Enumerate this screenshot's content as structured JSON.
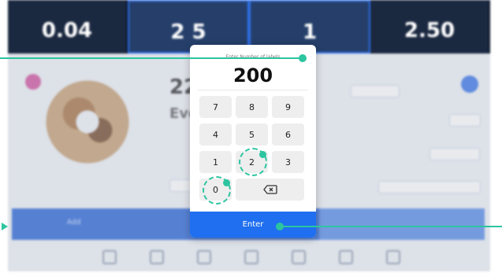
{
  "stats": [
    {
      "label": "",
      "value": "0.04"
    },
    {
      "label": "",
      "value": "2 5"
    },
    {
      "label": "",
      "value": "1"
    },
    {
      "label": "",
      "value": "2.50"
    }
  ],
  "background": {
    "big_number": "22",
    "sub_text": "Eve",
    "action_label": "Add"
  },
  "keypad": {
    "title": "Enter Number of labels",
    "value": "200",
    "keys": [
      "7",
      "8",
      "9",
      "4",
      "5",
      "6",
      "1",
      "2",
      "3",
      "0"
    ],
    "backspace_icon": "backspace-icon",
    "enter_label": "Enter"
  },
  "colors": {
    "accent": "#1f6ff0",
    "callout": "#2cc5a0",
    "header_bg": "#1a2840"
  }
}
